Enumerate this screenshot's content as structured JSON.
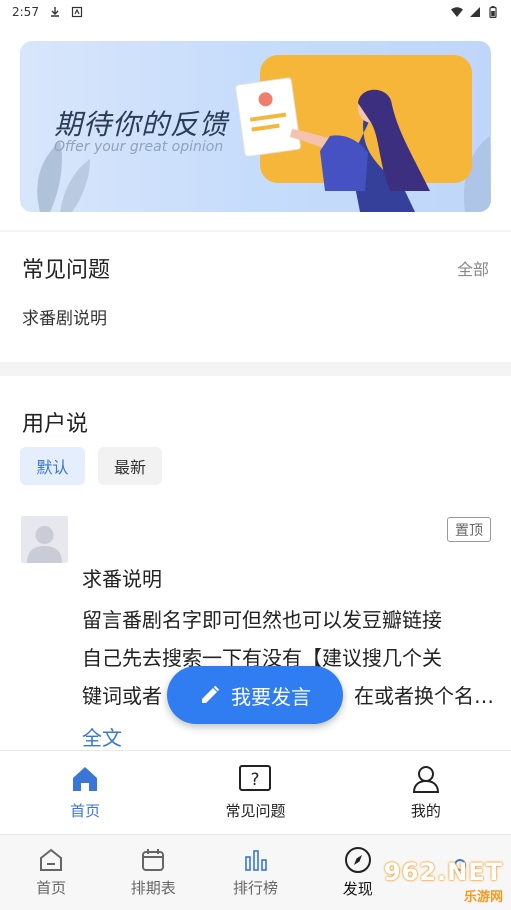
{
  "status_bar": {
    "time": "2:57"
  },
  "banner": {
    "title": "期待你的反馈",
    "subtitle": "Offer your great opinion"
  },
  "faq": {
    "title": "常见问题",
    "all_label": "全部",
    "items": [
      "求番剧说明"
    ]
  },
  "user_says": {
    "title": "用户说",
    "filters": [
      "默认",
      "最新"
    ],
    "post": {
      "badge": "置顶",
      "title": "求番说明",
      "body": "留言番剧名字即可但然也可以发豆瓣链接自己先去搜索一下有没有【建议搜几个关键词或者… 】… 在或者换个名…",
      "line1": "留言番剧名字即可但然也可以发豆瓣链接",
      "line2": "自己先去搜索一下有没有【建议搜几个关",
      "line3_left": "键词或者",
      "line3_right": "在或者换个名…",
      "more_label": "全文"
    }
  },
  "fab": {
    "label": "我要发言"
  },
  "inner_tabs": [
    {
      "label": "首页",
      "icon": "home-icon",
      "active": true
    },
    {
      "label": "常见问题",
      "icon": "question-icon",
      "active": false
    },
    {
      "label": "我的",
      "icon": "person-icon",
      "active": false
    }
  ],
  "outer_tabs": [
    {
      "label": "首页",
      "icon": "home-outline-icon"
    },
    {
      "label": "排期表",
      "icon": "calendar-icon"
    },
    {
      "label": "排行榜",
      "icon": "bar-chart-icon"
    },
    {
      "label": "发现",
      "icon": "compass-icon",
      "active": true
    },
    {
      "label": "",
      "icon": "profile-icon"
    }
  ],
  "watermark": {
    "top": "962.NET",
    "bottom": "乐游网"
  },
  "colors": {
    "accent": "#3a76d6",
    "fab": "#2f7df0",
    "chip_active_bg": "#e4eefc"
  }
}
